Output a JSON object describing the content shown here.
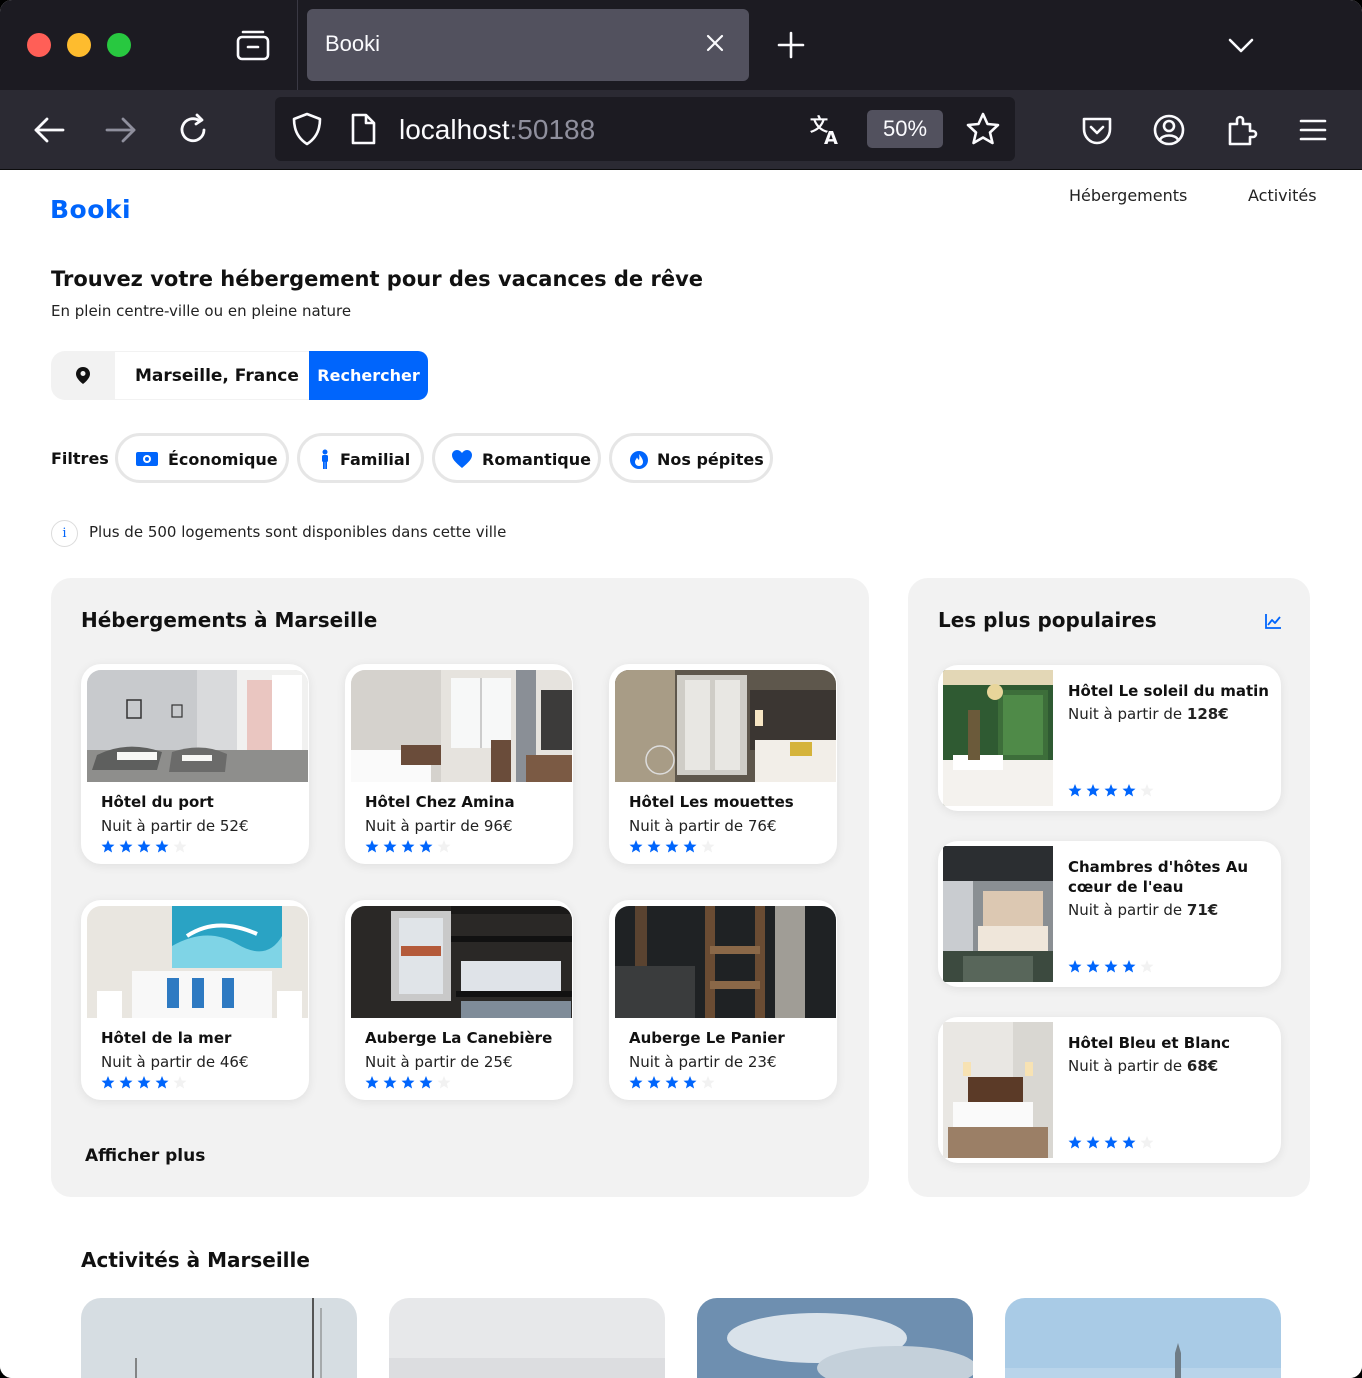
{
  "browser": {
    "tab_title": "Booki",
    "url_host": "localhost",
    "url_port": ":50188",
    "zoom": "50%"
  },
  "site": {
    "logo": "Booki",
    "nav": [
      "Hébergements",
      "Activités"
    ],
    "headline": "Trouvez votre hébergement pour des vacances de rêve",
    "subline": "En plein centre-ville ou en pleine nature",
    "search_value": "Marseille, France",
    "search_button": "Rechercher",
    "filters_label": "Filtres",
    "filters": [
      {
        "label": "Économique",
        "icon": "money-icon"
      },
      {
        "label": "Familial",
        "icon": "person-icon"
      },
      {
        "label": "Romantique",
        "icon": "heart-icon"
      },
      {
        "label": "Nos pépites",
        "icon": "flame-icon"
      }
    ],
    "info": "Plus de 500 logements sont disponibles dans cette ville",
    "accent_color": "#0065fc"
  },
  "lodgings": {
    "title": "Hébergements à Marseille",
    "more": "Afficher plus",
    "items": [
      {
        "name": "Hôtel du port",
        "price": "Nuit à partir de 52€",
        "rating": 4
      },
      {
        "name": "Hôtel Chez Amina",
        "price": "Nuit à partir de 96€",
        "rating": 4
      },
      {
        "name": "Hôtel Les mouettes",
        "price": "Nuit à partir de 76€",
        "rating": 4
      },
      {
        "name": "Hôtel de la mer",
        "price": "Nuit à partir de 46€",
        "rating": 4
      },
      {
        "name": "Auberge La Canebière",
        "price": "Nuit à partir de 25€",
        "rating": 4
      },
      {
        "name": "Auberge Le Panier",
        "price": "Nuit à partir de 23€",
        "rating": 4
      }
    ]
  },
  "popular": {
    "title": "Les plus populaires",
    "items": [
      {
        "name": "Hôtel Le soleil du matin",
        "price_prefix": "Nuit à partir de ",
        "price_value": "128€",
        "rating": 4
      },
      {
        "name": "Chambres d'hôtes Au cœur de l'eau",
        "price_prefix": "Nuit à partir de ",
        "price_value": "71€",
        "rating": 4
      },
      {
        "name": "Hôtel Bleu et Blanc",
        "price_prefix": "Nuit à partir de ",
        "price_value": "68€",
        "rating": 4
      }
    ]
  },
  "activities": {
    "title": "Activités à Marseille"
  }
}
